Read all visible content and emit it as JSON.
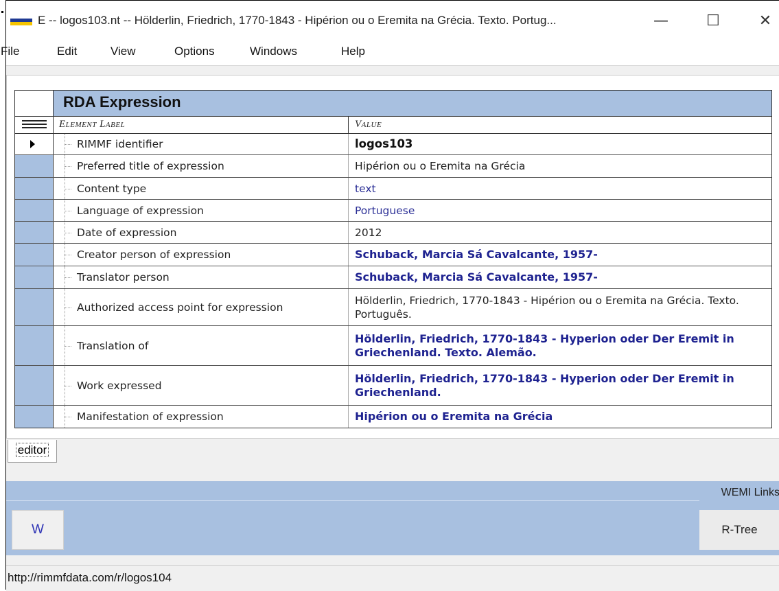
{
  "window": {
    "title": "E  --  logos103.nt  --  Hölderlin, Friedrich, 1770-1843 - Hipérion ou o Eremita na Grécia. Texto. Portug...",
    "minimize_glyph": "—",
    "maximize_glyph": "☐",
    "close_glyph": "✕",
    "icon_colors": [
      "#1f3a93",
      "#f5c400"
    ]
  },
  "menu": [
    "File",
    "Edit",
    "View",
    "Options",
    "Windows",
    "Help"
  ],
  "grid": {
    "title": "RDA Expression",
    "header_label": "Element Label",
    "header_value": "Value",
    "rows": [
      {
        "label": "RIMMF identifier",
        "value": "logos103"
      },
      {
        "label": "Preferred title of expression",
        "value": "Hipérion ou o Eremita na Grécia"
      },
      {
        "label": "Content type",
        "value": "text"
      },
      {
        "label": "Language of expression",
        "value": "Portuguese"
      },
      {
        "label": "Date of expression",
        "value": "2012"
      },
      {
        "label": "Creator person of expression",
        "value": "Schuback, Marcia Sá Cavalcante, 1957-"
      },
      {
        "label": "Translator person",
        "value": "Schuback, Marcia Sá Cavalcante, 1957-"
      },
      {
        "label": "Authorized access point for expression",
        "value": "Hölderlin, Friedrich, 1770-1843 - Hipérion ou o Eremita na Grécia. Texto. Português."
      },
      {
        "label": "Translation of",
        "value": "Hölderlin, Friedrich, 1770-1843 - Hyperion oder Der Eremit in Griechenland. Texto. Alemão."
      },
      {
        "label": "Work expressed",
        "value": "Hölderlin, Friedrich, 1770-1843 - Hyperion oder Der Eremit in Griechenland."
      },
      {
        "label": "Manifestation of expression",
        "value": "Hipérion ou o Eremita na Grécia"
      }
    ]
  },
  "tabs": {
    "editor": "editor"
  },
  "links": {
    "title": "WEMI Links",
    "w_button": "W",
    "rtree_button": "R-Tree"
  },
  "status": {
    "url": "http://rimmfdata.com/r/logos104"
  },
  "colors": {
    "grid_accent": "#a8c0e0",
    "link": "#2b2f96"
  }
}
